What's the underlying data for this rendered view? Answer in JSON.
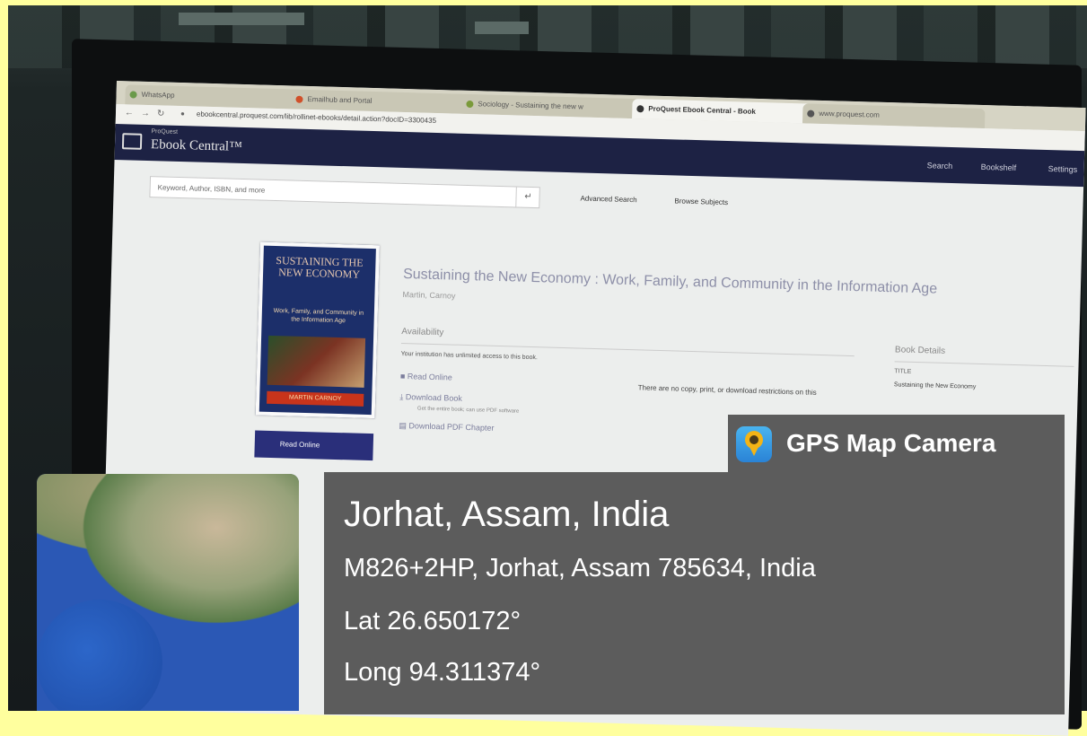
{
  "browser": {
    "tabs": [
      {
        "label": "WhatsApp"
      },
      {
        "label": "Emailhub and Portal"
      },
      {
        "label": "Sociology - Sustaining the new w"
      },
      {
        "label": "ProQuest Ebook Central - Book"
      },
      {
        "label": "www.proquest.com"
      }
    ],
    "url": "ebookcentral.proquest.com/lib/rollinet-ebooks/detail.action?docID=3300435"
  },
  "site": {
    "brand_small": "ProQuest",
    "brand": "Ebook Central™",
    "nav": [
      "Search",
      "Bookshelf",
      "Settings"
    ],
    "search_placeholder": "Keyword, Author, ISBN, and more",
    "search_button": "↵",
    "advanced_search": "Advanced Search",
    "browse_subjects": "Browse Subjects"
  },
  "book": {
    "cover_title": "SUSTAINING THE NEW ECONOMY",
    "cover_subtitle": "Work, Family, and Community in the Information Age",
    "cover_author": "MARTIN CARNOY",
    "title": "Sustaining the New Economy : Work, Family, and Community in the Information Age",
    "author": "Martin, Carnoy",
    "read_online_button": "Read Online",
    "availability_heading": "Availability",
    "availability_note": "Your institution has unlimited access to this book.",
    "actions": [
      {
        "label": "Read Online",
        "sub": ""
      },
      {
        "label": "Download Book",
        "sub": "Get the entire book; can use PDF software"
      },
      {
        "label": "Download PDF Chapter",
        "sub": ""
      }
    ],
    "no_copy_note": "There are no copy, print, or download restrictions on this",
    "details_heading": "Book Details",
    "details": [
      {
        "label": "TITLE",
        "value": "Sustaining the New Economy"
      }
    ]
  },
  "gps_overlay": {
    "app_name": "GPS Map Camera",
    "city": "Jorhat, Assam, India",
    "address": "M826+2HP, Jorhat, Assam 785634, India",
    "latitude": "Lat 26.650172°",
    "longitude": "Long 94.311374°"
  },
  "colors": {
    "header_bg": "#1d2244",
    "overlay_bg": "#484848",
    "frame_bg": "#ffff9e",
    "app_icon": "#2a83d6"
  }
}
